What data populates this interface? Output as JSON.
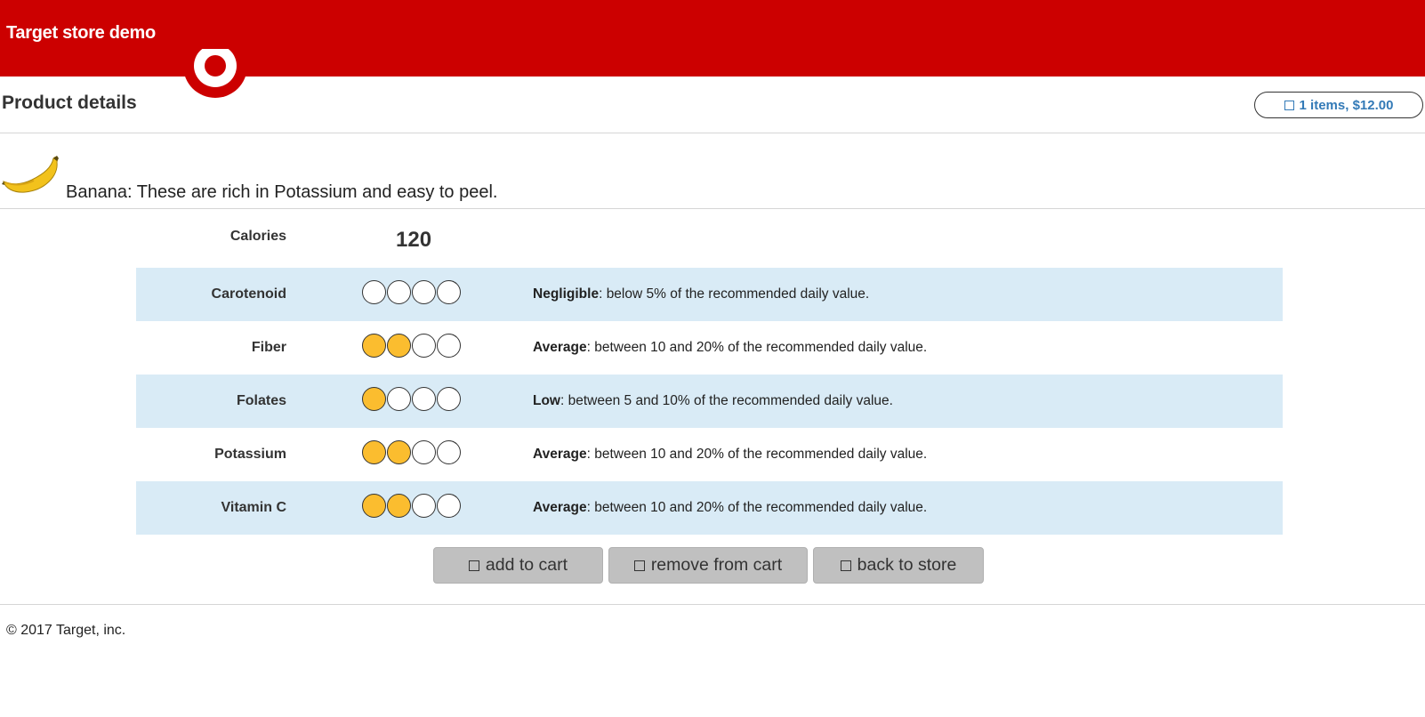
{
  "header": {
    "brand": "Target store demo"
  },
  "page": {
    "title": "Product details"
  },
  "cart": {
    "summary_count": "1 items,",
    "summary_total": "$12.00"
  },
  "product": {
    "description": "Banana: These are rich in Potassium and easy to peel."
  },
  "calories": {
    "label": "Calories",
    "value": "120"
  },
  "nutrients": [
    {
      "label": "Carotenoid",
      "level": 0,
      "max": 4,
      "term": "Negligible",
      "text": ": below 5% of the recommended daily value."
    },
    {
      "label": "Fiber",
      "level": 2,
      "max": 4,
      "term": "Average",
      "text": ": between 10 and 20% of the recommended daily value."
    },
    {
      "label": "Folates",
      "level": 1,
      "max": 4,
      "term": "Low",
      "text": ": between 5 and 10% of the recommended daily value."
    },
    {
      "label": "Potassium",
      "level": 2,
      "max": 4,
      "term": "Average",
      "text": ": between 10 and 20% of the recommended daily value."
    },
    {
      "label": "Vitamin C",
      "level": 2,
      "max": 4,
      "term": "Average",
      "text": ": between 10 and 20% of the recommended daily value."
    }
  ],
  "actions": {
    "add_label": "add to cart",
    "remove_label": "remove from cart",
    "back_label": "back to store"
  },
  "footer": {
    "copyright": "© 2017 Target, inc."
  },
  "colors": {
    "brand_red": "#cc0000",
    "row_shade": "#d9ebf6",
    "rating_fill": "#fbbd2f",
    "link_blue": "#337ab7"
  },
  "icons": {
    "logo": "target-bullseye-logo",
    "product_image": "banana-image",
    "button_icon": "checkbox-square-icon"
  }
}
